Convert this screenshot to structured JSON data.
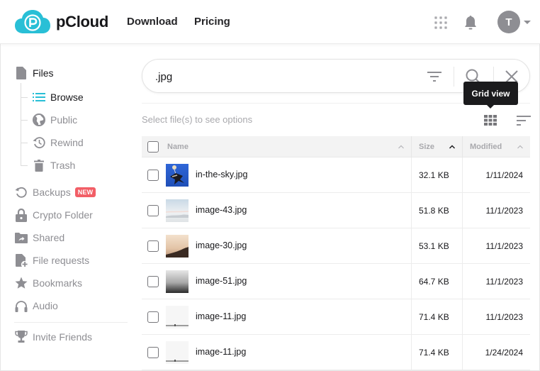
{
  "header": {
    "brand": "pCloud",
    "nav": [
      {
        "label": "Download"
      },
      {
        "label": "Pricing"
      }
    ],
    "avatar_initial": "T",
    "brand_color": "#29bfd6"
  },
  "sidebar": {
    "files": {
      "label": "Files",
      "icon": "file-icon"
    },
    "sub_items": [
      {
        "label": "Browse",
        "icon": "list-icon",
        "active": true
      },
      {
        "label": "Public",
        "icon": "globe-icon"
      },
      {
        "label": "Rewind",
        "icon": "history-icon"
      },
      {
        "label": "Trash",
        "icon": "trash-icon"
      }
    ],
    "items": [
      {
        "label": "Backups",
        "icon": "backup-icon",
        "badge": "NEW"
      },
      {
        "label": "Crypto Folder",
        "icon": "lock-icon"
      },
      {
        "label": "Shared",
        "icon": "shared-folder-icon"
      },
      {
        "label": "File requests",
        "icon": "file-request-icon"
      },
      {
        "label": "Bookmarks",
        "icon": "star-icon"
      },
      {
        "label": "Audio",
        "icon": "headphones-icon"
      }
    ],
    "invite": {
      "label": "Invite Friends",
      "icon": "trophy-icon"
    },
    "badge_color": "#f25e66"
  },
  "search": {
    "value": ".jpg"
  },
  "toolbar": {
    "hint": "Select file(s) to see options",
    "tooltip": "Grid view"
  },
  "table": {
    "columns": [
      {
        "label": "Name"
      },
      {
        "label": "Size"
      },
      {
        "label": "Modified"
      }
    ],
    "rows": [
      {
        "name": "in-the-sky.jpg",
        "size": "32.1 KB",
        "modified": "1/11/2024",
        "thumb": "sky"
      },
      {
        "name": "image-43.jpg",
        "size": "51.8 KB",
        "modified": "11/1/2023",
        "thumb": "haze"
      },
      {
        "name": "image-30.jpg",
        "size": "53.1 KB",
        "modified": "11/1/2023",
        "thumb": "sand"
      },
      {
        "name": "image-51.jpg",
        "size": "64.7 KB",
        "modified": "11/1/2023",
        "thumb": "fog"
      },
      {
        "name": "image-11.jpg",
        "size": "71.4 KB",
        "modified": "11/1/2023",
        "thumb": "white"
      },
      {
        "name": "image-11.jpg",
        "size": "71.4 KB",
        "modified": "1/24/2024",
        "thumb": "white"
      }
    ]
  }
}
